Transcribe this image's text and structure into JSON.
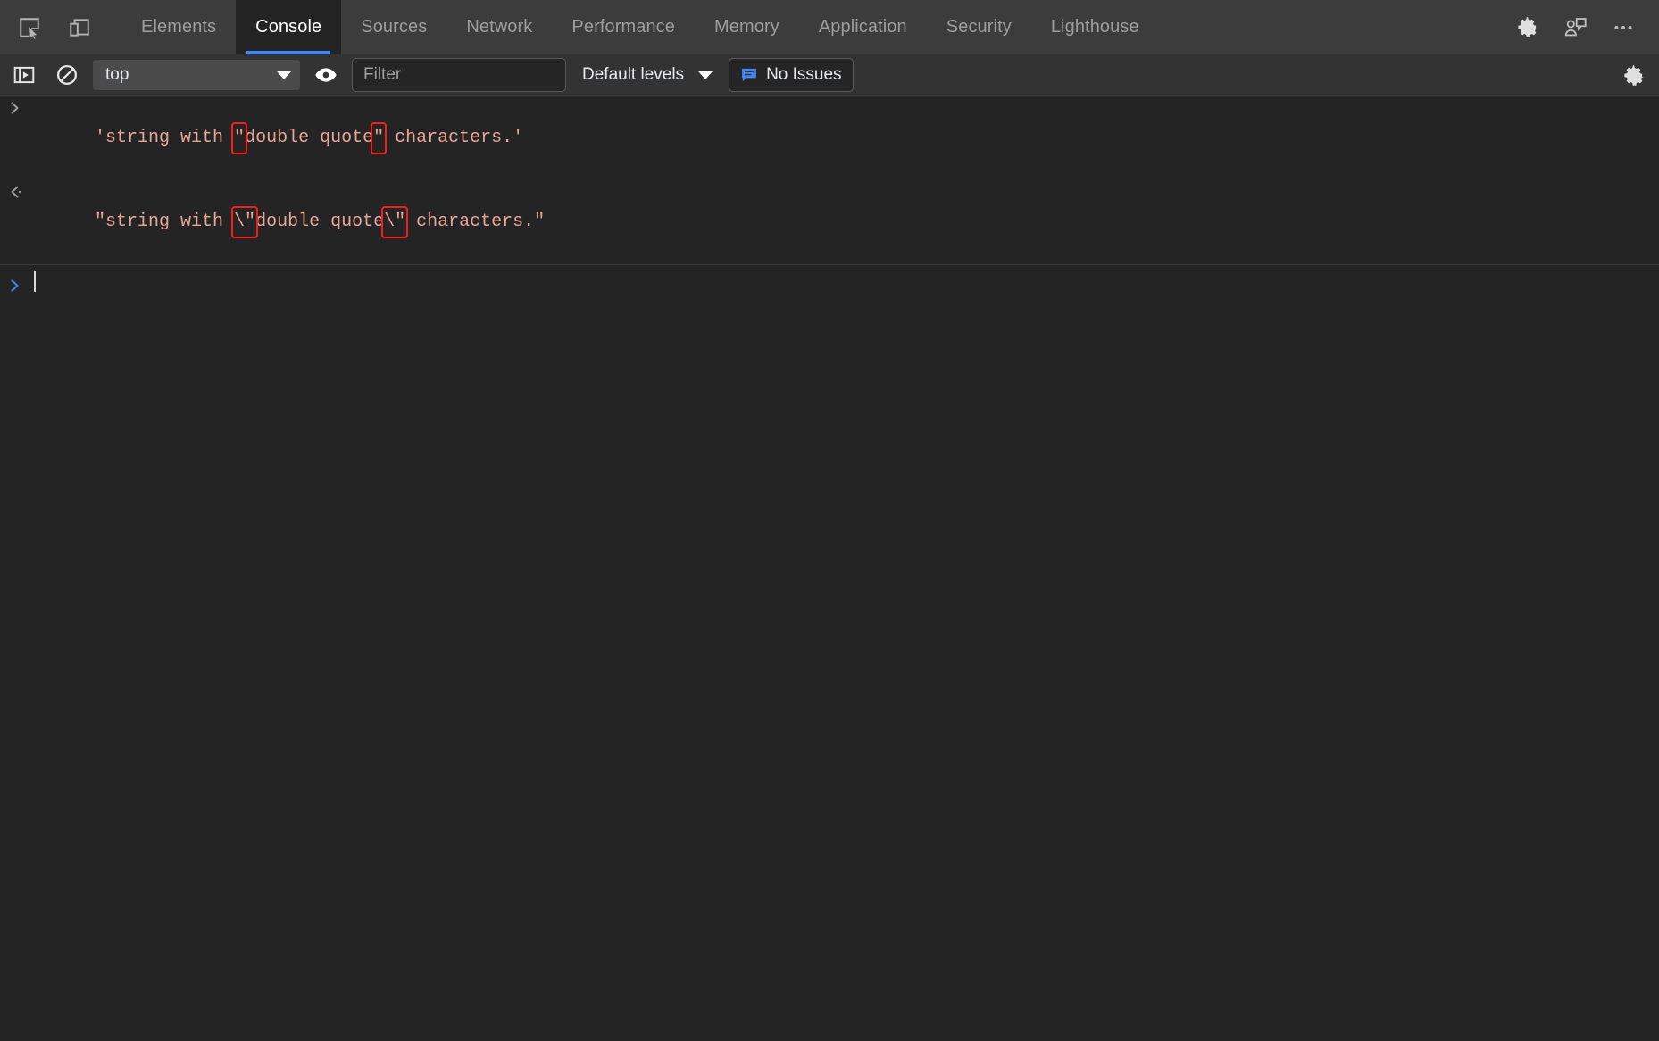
{
  "window": {
    "background": "#242424",
    "toolbar_background": "#333333",
    "tabbar_background": "#3c3c3c",
    "accent": "#4285f4",
    "highlight_box_color": "#f41f1f",
    "string_color": "#e8a796"
  },
  "tabbar": {
    "inspect_icon": "inspect-element-icon",
    "device_icon": "device-toolbar-icon",
    "tabs": [
      {
        "label": "Elements",
        "active": false
      },
      {
        "label": "Console",
        "active": true
      },
      {
        "label": "Sources",
        "active": false
      },
      {
        "label": "Network",
        "active": false
      },
      {
        "label": "Performance",
        "active": false
      },
      {
        "label": "Memory",
        "active": false
      },
      {
        "label": "Application",
        "active": false
      },
      {
        "label": "Security",
        "active": false
      },
      {
        "label": "Lighthouse",
        "active": false
      }
    ],
    "right_icons": [
      {
        "name": "gear-icon",
        "label": "Settings"
      },
      {
        "name": "feedback-icon",
        "label": "Feedback"
      },
      {
        "name": "more-options-icon",
        "label": "More options"
      }
    ]
  },
  "console_toolbar": {
    "sidebar_toggle_icon": "console-sidebar-icon",
    "clear_console_icon": "clear-console-icon",
    "context": {
      "selected": "top",
      "options": [
        "top"
      ]
    },
    "live_expression_icon": "eye-icon",
    "filter": {
      "placeholder": "Filter",
      "value": ""
    },
    "levels": {
      "label": "Default levels"
    },
    "issues": {
      "label": "No Issues",
      "icon": "issues-bubble-icon"
    },
    "settings_icon": "gear-icon"
  },
  "console": {
    "messages": [
      {
        "type": "input",
        "gutter_icon": "input-chevron-icon",
        "segments": [
          {
            "text": "'string with ",
            "highlight": false
          },
          {
            "text": "\"",
            "highlight": true
          },
          {
            "text": "double quote",
            "highlight": false
          },
          {
            "text": "\"",
            "highlight": true
          },
          {
            "text": " characters.'",
            "highlight": false
          }
        ],
        "full_text": "'string with \"double quote\" characters.'"
      },
      {
        "type": "output",
        "gutter_icon": "output-chevron-icon",
        "segments": [
          {
            "text": "\"string with ",
            "highlight": false
          },
          {
            "text": "\\\"",
            "highlight": true
          },
          {
            "text": "double quote",
            "highlight": false
          },
          {
            "text": "\\\"",
            "highlight": true
          },
          {
            "text": " characters.\"",
            "highlight": false
          }
        ],
        "full_text": "\"string with \\\"double quote\\\" characters.\""
      }
    ],
    "prompt": {
      "gutter_icon": "prompt-chevron-icon",
      "value": ""
    }
  }
}
